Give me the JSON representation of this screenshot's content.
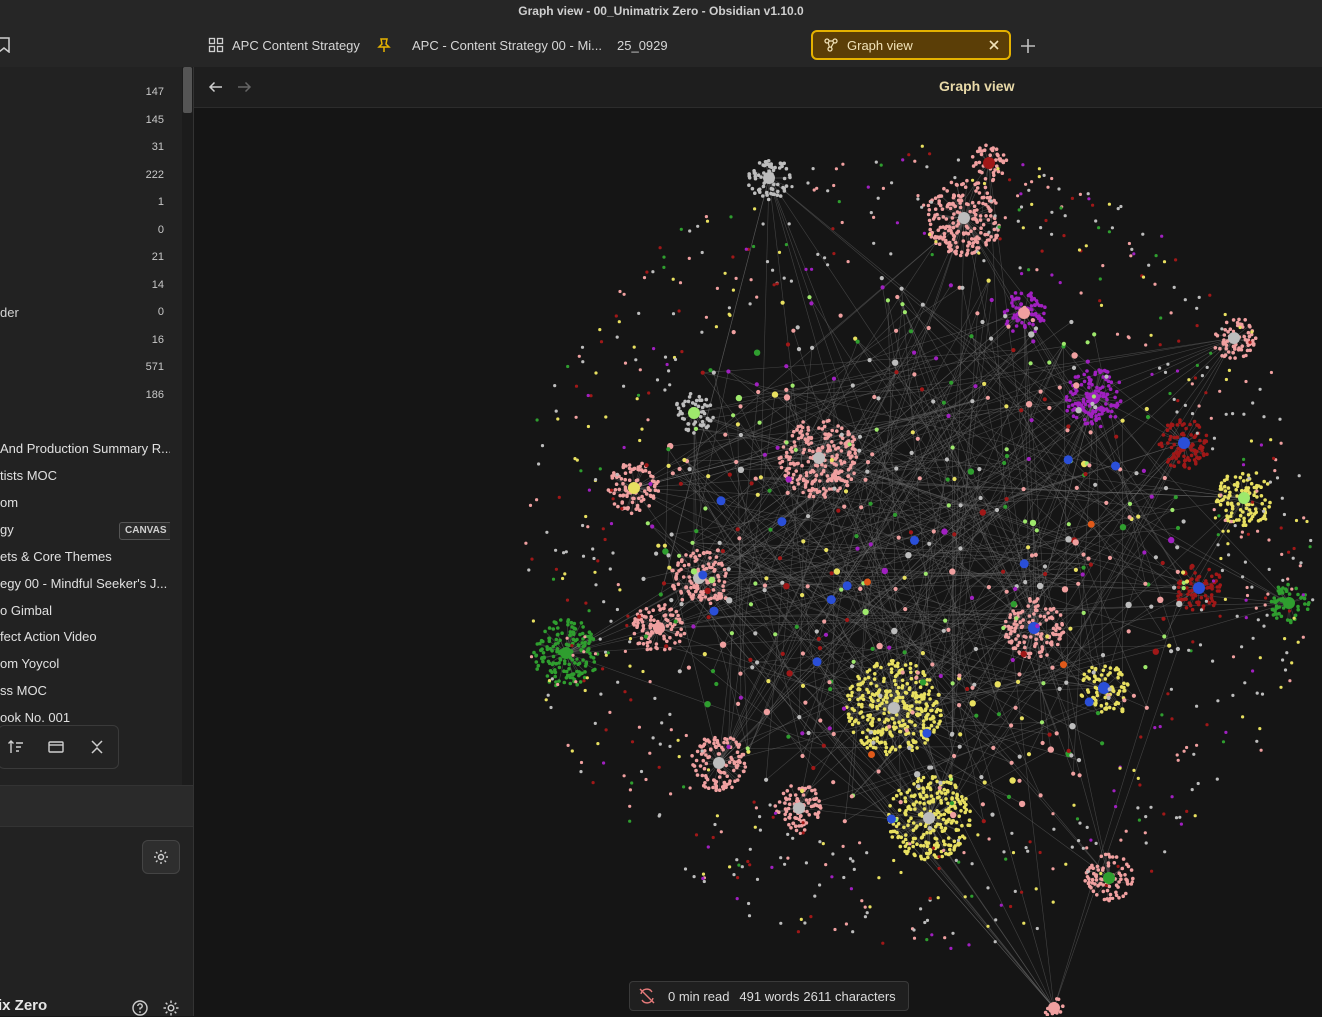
{
  "window": {
    "title": "Graph view - 00_Unimatrix Zero - Obsidian v1.10.0"
  },
  "tabs": [
    {
      "label": "APC Content Strategy",
      "icon": "canvas-grid-icon"
    },
    {
      "label": "APC - Content Strategy 00 - Mi...",
      "icon": "pin-icon"
    },
    {
      "label": "25_0929"
    },
    {
      "label": "Graph view",
      "icon": "graph-icon",
      "active": true
    }
  ],
  "sidebar": {
    "counts": [
      {
        "label": "",
        "count": "147"
      },
      {
        "label": "",
        "count": "145"
      },
      {
        "label": "",
        "count": "31"
      },
      {
        "label": "",
        "count": "222"
      },
      {
        "label": "",
        "count": "1"
      },
      {
        "label": "",
        "count": "0"
      },
      {
        "label": "",
        "count": "21"
      },
      {
        "label": "",
        "count": "14"
      },
      {
        "label": "der",
        "count": "0"
      },
      {
        "label": "",
        "count": "16"
      },
      {
        "label": "",
        "count": "571"
      },
      {
        "label": "",
        "count": "186"
      }
    ],
    "files": [
      {
        "label": "And Production Summary R..."
      },
      {
        "label": "tists MOC"
      },
      {
        "label": "om"
      },
      {
        "label": "gy",
        "badge": "CANVAS"
      },
      {
        "label": "ets & Core Themes"
      },
      {
        "label": "egy 00 - Mindful Seeker's J..."
      },
      {
        "label": "o Gimbal"
      },
      {
        "label": "fect Action Video"
      },
      {
        "label": "om Yoycol"
      },
      {
        "label": "ss MOC"
      },
      {
        "label": "ook No. 001"
      }
    ],
    "vault_name": "ix Zero"
  },
  "view": {
    "title": "Graph view"
  },
  "status": {
    "read_time": "0 min read",
    "words": "491 words",
    "characters": "2611 characters"
  },
  "colors": {
    "accent": "#e5b200",
    "active_tab_bg": "#5b3e07",
    "node_pink": "#f0a0a0",
    "node_yellow": "#e8e060",
    "node_gray": "#bdbdbd",
    "node_green": "#2f9e2f",
    "node_lightgreen": "#9ee86c",
    "node_blue": "#2a4fd8",
    "node_purple": "#a020c0",
    "node_darkred": "#a01818",
    "node_orange": "#e05a1a",
    "edge": "#6a6a6a"
  }
}
